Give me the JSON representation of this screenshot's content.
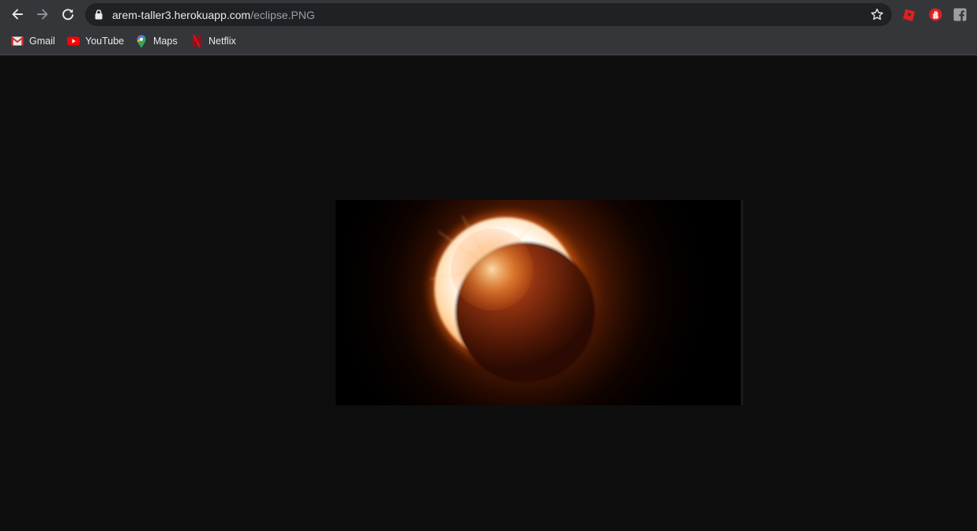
{
  "browser": {
    "url_host": "arem-taller3.herokuapp.com",
    "url_path": "/eclipse.PNG",
    "theme_color": "#35363a",
    "omnibox_color": "#202124"
  },
  "bookmarks": [
    {
      "label": "Gmail",
      "icon": "gmail-icon"
    },
    {
      "label": "YouTube",
      "icon": "youtube-icon"
    },
    {
      "label": "Maps",
      "icon": "maps-icon"
    },
    {
      "label": "Netflix",
      "icon": "netflix-icon"
    }
  ],
  "extensions": [
    {
      "icon": "roblox-icon",
      "color": "#e02020"
    },
    {
      "icon": "stop-hand-icon",
      "color": "#e02020"
    },
    {
      "icon": "facebook-icon",
      "color": "#9e9e9e"
    }
  ],
  "content": {
    "image_subject": "solar eclipse",
    "background": "#0e0e0e"
  }
}
